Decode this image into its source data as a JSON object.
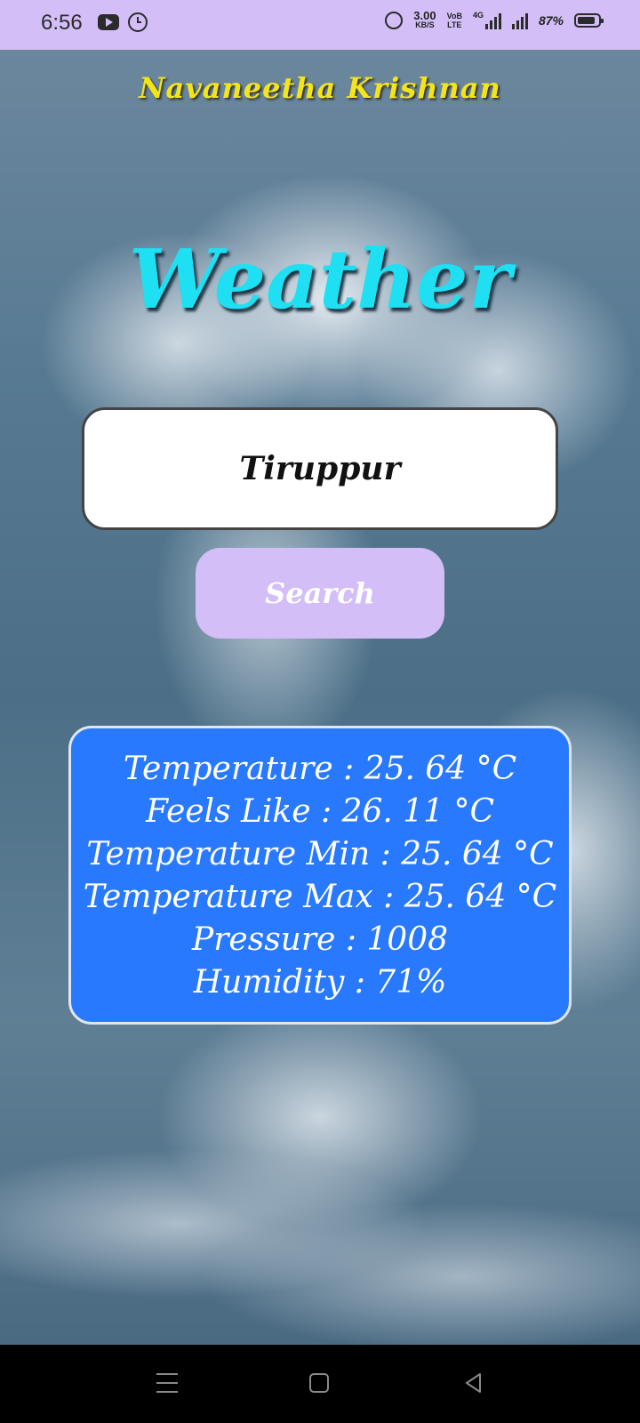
{
  "status_bar": {
    "time": "6:56",
    "net_speed_value": "3.00",
    "net_speed_unit": "KB/S",
    "volte_top": "VoB",
    "volte_bottom": "LTE",
    "network_type": "4G",
    "battery_percent": "87%",
    "battery_level": 0.87,
    "icons": [
      "youtube-icon",
      "alarm-icon",
      "alarm-icon",
      "signal-icon",
      "signal-icon",
      "battery-icon"
    ]
  },
  "app": {
    "author": "Navaneetha Krishnan",
    "title": "Weather",
    "search_value": "Tiruppur",
    "search_button_label": "Search",
    "results": [
      "Temperature : 25. 64 °C",
      "Feels Like : 26. 11 °C",
      "Temperature Min : 25. 64 °C",
      "Temperature Max : 25. 64 °C",
      "Pressure : 1008",
      "Humidity : 71%"
    ]
  },
  "colors": {
    "status_bar_bg": "#d3bef7",
    "author_text": "#f4e51a",
    "title_text": "#1fe0f2",
    "button_bg": "#d3bef7",
    "card_bg": "#2979ff"
  },
  "nav_bar": {
    "icons": [
      "menu-icon",
      "home-icon",
      "back-icon"
    ]
  }
}
